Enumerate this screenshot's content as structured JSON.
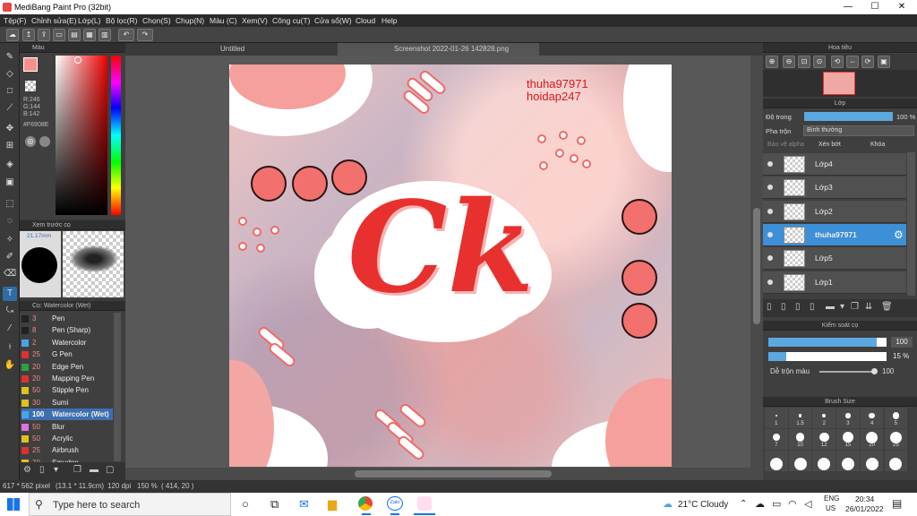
{
  "window": {
    "title": "MediBang Paint Pro (32bit)",
    "minimize": "—",
    "maximize": "☐",
    "close": "✕"
  },
  "menu": [
    "Tệp(F)",
    "Chỉnh sửa(E)",
    "Lớp(L)",
    "Bộ lọc(R)",
    "Chọn(S)",
    "Chụp(N)",
    "Màu (C)",
    "Xem(V)",
    "Công cụ(T)",
    "Cửa sổ(W)",
    "Cloud",
    "Help"
  ],
  "color_panel": {
    "title": "Màu",
    "r": "R:246",
    "g": "G:144",
    "b": "B:142",
    "hex": "#F6908E",
    "primary": "#f6908e"
  },
  "brush_preview": {
    "title": "Xem trước cọ",
    "size": "21.17mm"
  },
  "brush_panel": {
    "title": "Cọ: Watercolor (Wet)",
    "items": [
      {
        "size": "3",
        "name": "Pen",
        "color": "#222222"
      },
      {
        "size": "8",
        "name": "Pen (Sharp)",
        "color": "#222222"
      },
      {
        "size": "2",
        "name": "Watercolor",
        "color": "#4aa3e8"
      },
      {
        "size": "25",
        "name": "G Pen",
        "color": "#e03030"
      },
      {
        "size": "20",
        "name": "Edge Pen",
        "color": "#30a040"
      },
      {
        "size": "20",
        "name": "Mapping Pen",
        "color": "#e03030"
      },
      {
        "size": "50",
        "name": "Stipple Pen",
        "color": "#e0c020"
      },
      {
        "size": "30",
        "name": "Sumi",
        "color": "#e0c020"
      },
      {
        "size": "100",
        "name": "Watercolor (Wet)",
        "color": "#4aa3e8"
      },
      {
        "size": "50",
        "name": "Blur",
        "color": "#e070e0"
      },
      {
        "size": "50",
        "name": "Acrylic",
        "color": "#e0c020"
      },
      {
        "size": "25",
        "name": "Airbrush",
        "color": "#e03030"
      },
      {
        "size": "70",
        "name": "Smudge",
        "color": "#e0c020"
      }
    ]
  },
  "tabs": {
    "untitled": "Untitled",
    "active": "Screenshot 2022-01-26 142828.png"
  },
  "canvas": {
    "watermark1": "thuha97971",
    "watermark2": "hoidap247",
    "logo": "Ck"
  },
  "navigator": {
    "title": "Hoa tiêu"
  },
  "layers": {
    "title": "Lớp",
    "opacity_label": "Độ trong",
    "opacity_value": "100 %",
    "blend_label": "Pha trộn",
    "blend_value": "Bình thường",
    "protect_alpha": "Bảo vệ alpha",
    "clip": "Xén bớt",
    "lock": "Khóa",
    "items": [
      {
        "name": "Lớp4",
        "selected": false
      },
      {
        "name": "Lớp3",
        "selected": false
      },
      {
        "name": "Lớp2",
        "selected": false
      },
      {
        "name": "thuha97971",
        "selected": true
      },
      {
        "name": "Lớp5",
        "selected": false
      },
      {
        "name": "Lớp1",
        "selected": false
      }
    ]
  },
  "brush_control": {
    "title": "Kiểm soát cọ",
    "size_value": "100",
    "size_fill": 0.92,
    "opacity_value": "15 %",
    "opacity_fill": 0.15,
    "mix_label": "Dễ trộn màu",
    "mix_value": "100"
  },
  "brush_size": {
    "title": "Brush Size",
    "labels": [
      "1",
      "1.5",
      "2",
      "3",
      "4",
      "5",
      "7",
      "10",
      "12",
      "15",
      "20",
      "25"
    ]
  },
  "status": {
    "dimensions": "617 * 562 pixel",
    "physical": "(13.1 * 11.9cm)",
    "dpi": "120 dpi",
    "zoom": "150 %",
    "coords": "( 414, 20 )"
  },
  "taskbar": {
    "search_placeholder": "Type here to search",
    "weather": "21°C  Cloudy",
    "lang1": "ENG",
    "lang2": "US",
    "time": "20:34",
    "date": "26/01/2022"
  }
}
